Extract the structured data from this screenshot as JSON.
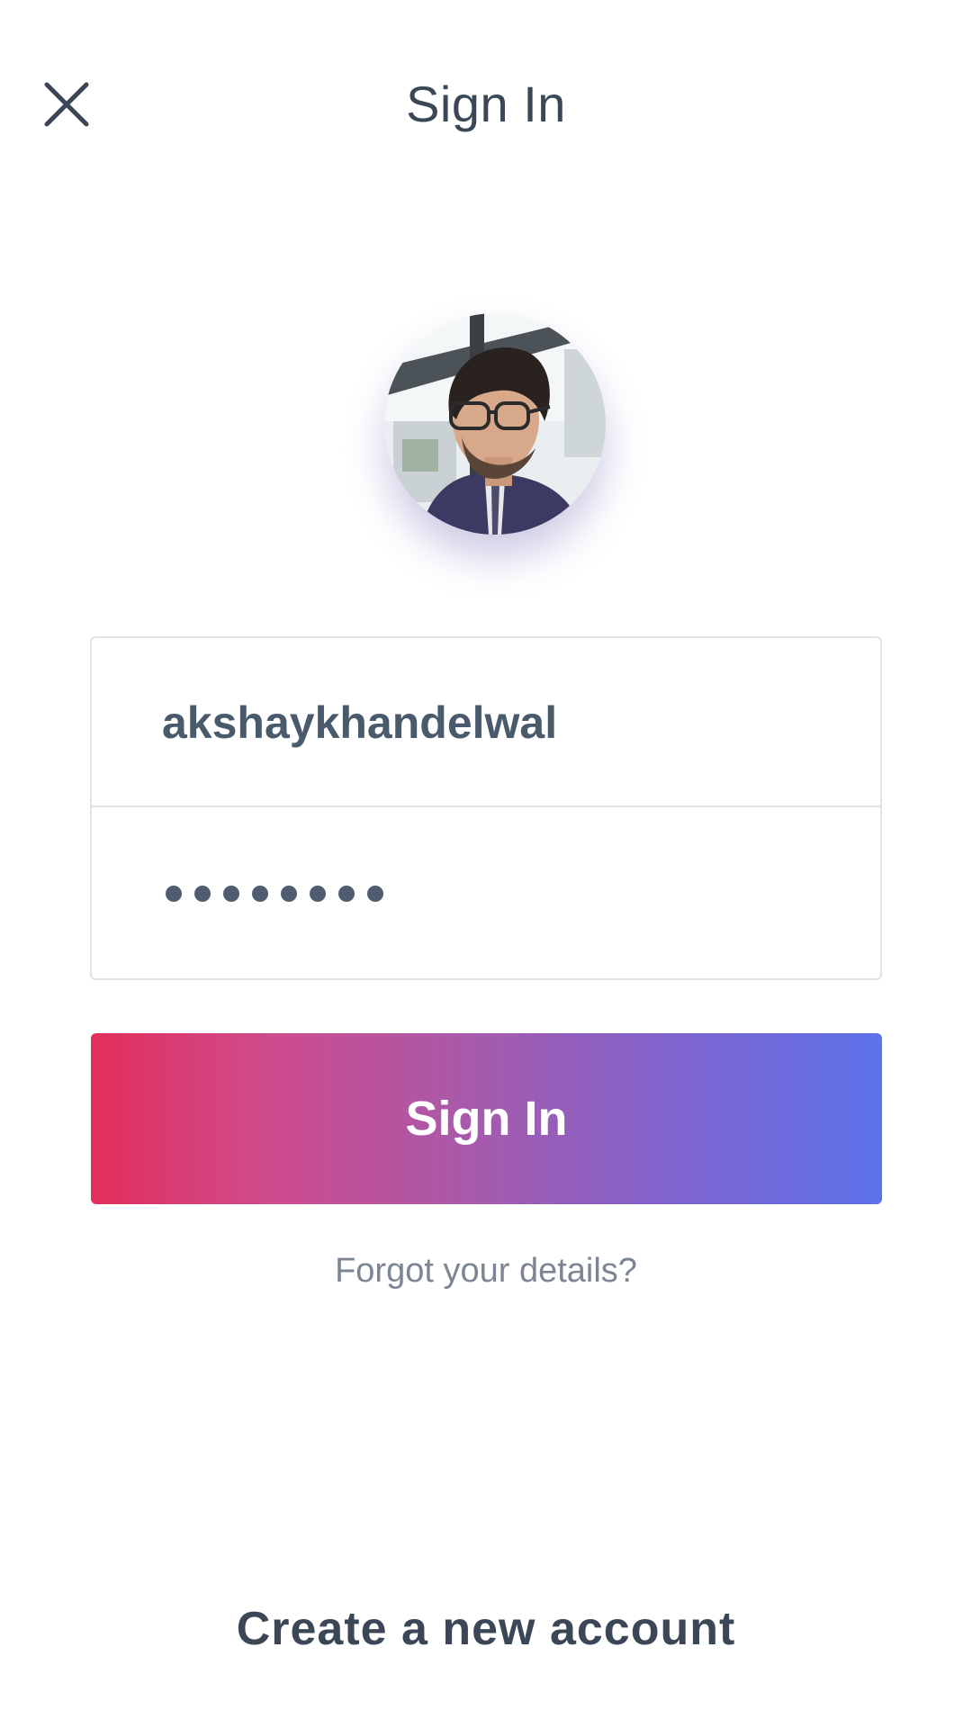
{
  "header": {
    "title": "Sign In",
    "close_icon": "close-icon"
  },
  "profile": {
    "avatar_icon": "user-avatar-photo"
  },
  "form": {
    "username_value": "akshaykhandelwal",
    "password_masked_length": 8
  },
  "actions": {
    "signin_label": "Sign In",
    "forgot_label": "Forgot your details?",
    "create_account_label": "Create a new account"
  },
  "colors": {
    "text_primary": "#3b4757",
    "text_secondary": "#7b8594",
    "button_gradient_start": "#e22e5a",
    "button_gradient_end": "#5c72ea",
    "border": "#e3e3e6"
  }
}
